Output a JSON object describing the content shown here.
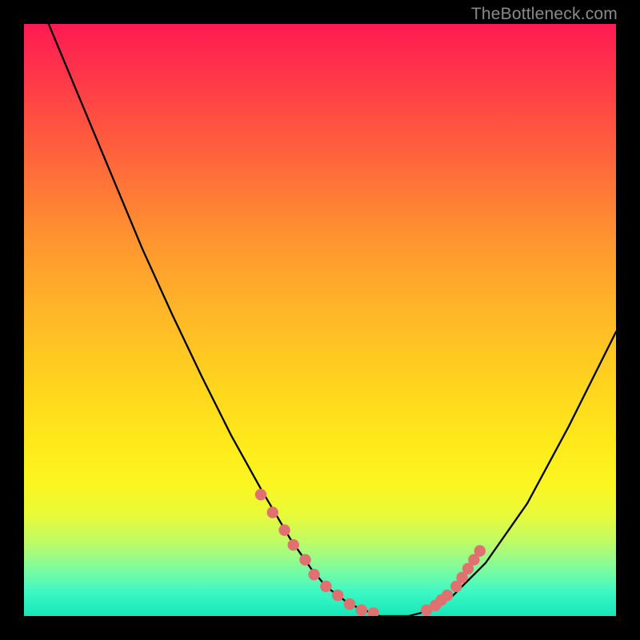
{
  "watermark": "TheBottleneck.com",
  "chart_data": {
    "type": "line",
    "title": "",
    "xlabel": "",
    "ylabel": "",
    "xlim": [
      0,
      100
    ],
    "ylim": [
      0,
      100
    ],
    "grid": false,
    "series": [
      {
        "name": "curve",
        "x": [
          0,
          5,
          10,
          15,
          20,
          25,
          30,
          35,
          40,
          45,
          48.5,
          51,
          55,
          60,
          65,
          67,
          72,
          78,
          85,
          92,
          100
        ],
        "y": [
          110,
          98,
          86,
          74,
          62,
          51,
          40.5,
          30.5,
          21.5,
          13,
          8,
          5,
          2,
          0,
          0,
          0.5,
          3,
          9,
          19,
          32,
          48
        ],
        "color": "#000000",
        "marker": false
      },
      {
        "name": "fit-markers-left",
        "x": [
          40,
          42,
          44,
          45.5,
          47.5,
          49,
          51,
          53,
          55,
          57,
          59
        ],
        "y": [
          20.5,
          17.5,
          14.5,
          12,
          9.5,
          7,
          5,
          3.5,
          2,
          1,
          0.5
        ],
        "color": "#e17070",
        "marker": true
      },
      {
        "name": "fit-markers-right",
        "x": [
          68,
          69.5,
          70.5,
          71.5,
          73,
          74,
          75,
          76,
          77
        ],
        "y": [
          1,
          1.8,
          2.7,
          3.5,
          5,
          6.5,
          8,
          9.5,
          11
        ],
        "color": "#e17070",
        "marker": true
      }
    ],
    "note": "Axis units/ticks are not shown in the image; x and y are normalized 0–100 (percent of plot area). y measures height from the bottom (green) edge."
  }
}
